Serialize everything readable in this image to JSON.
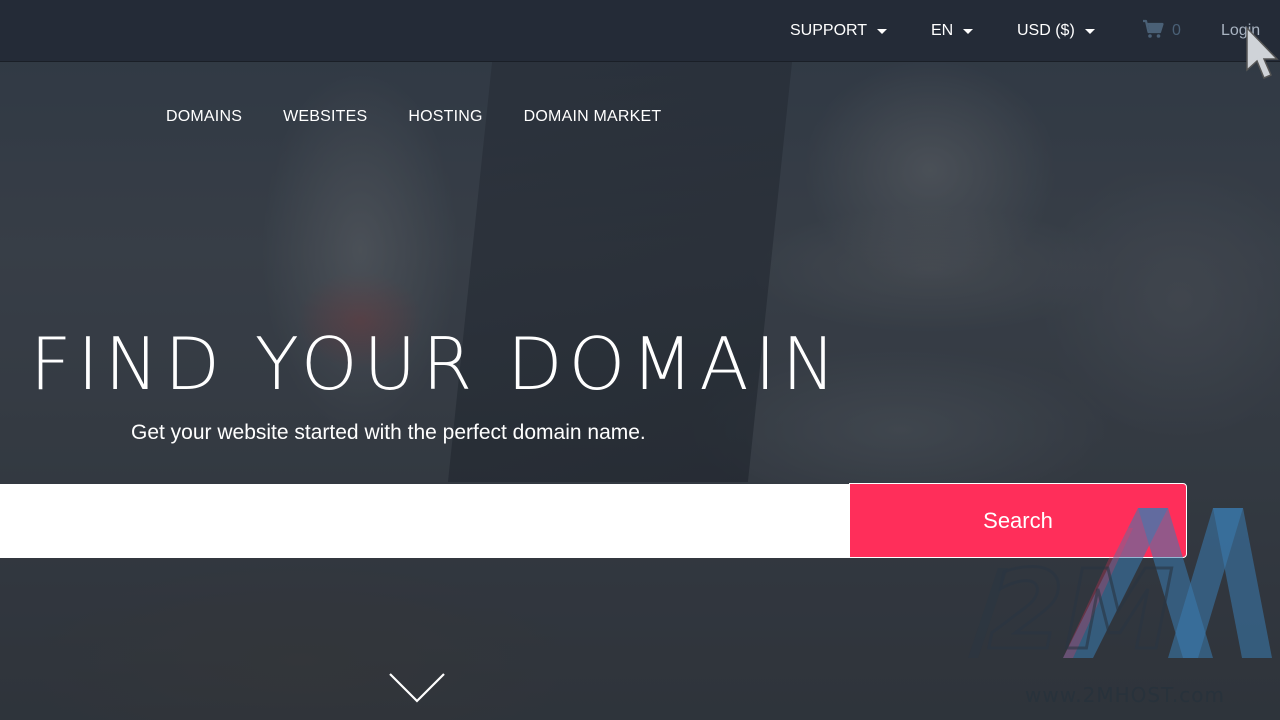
{
  "topbar": {
    "support": "SUPPORT",
    "language": "EN",
    "currency": "USD ($)",
    "cart_icon": "shopping-cart-icon",
    "cart_count": "0",
    "login": "Login"
  },
  "nav": {
    "items": [
      "DOMAINS",
      "WEBSITES",
      "HOSTING",
      "DOMAIN MARKET"
    ]
  },
  "hero": {
    "title": "FIND YOUR DOMAIN",
    "subtitle": "Get your website started with the perfect domain name."
  },
  "search": {
    "value": "",
    "button_label": "Search"
  },
  "watermark": {
    "logo_text": "2M",
    "url": "www.2MHOST.com"
  },
  "colors": {
    "topbar_bg": "#242b37",
    "accent": "#ff2e5a",
    "watermark_blue": "#3a7bb0"
  }
}
